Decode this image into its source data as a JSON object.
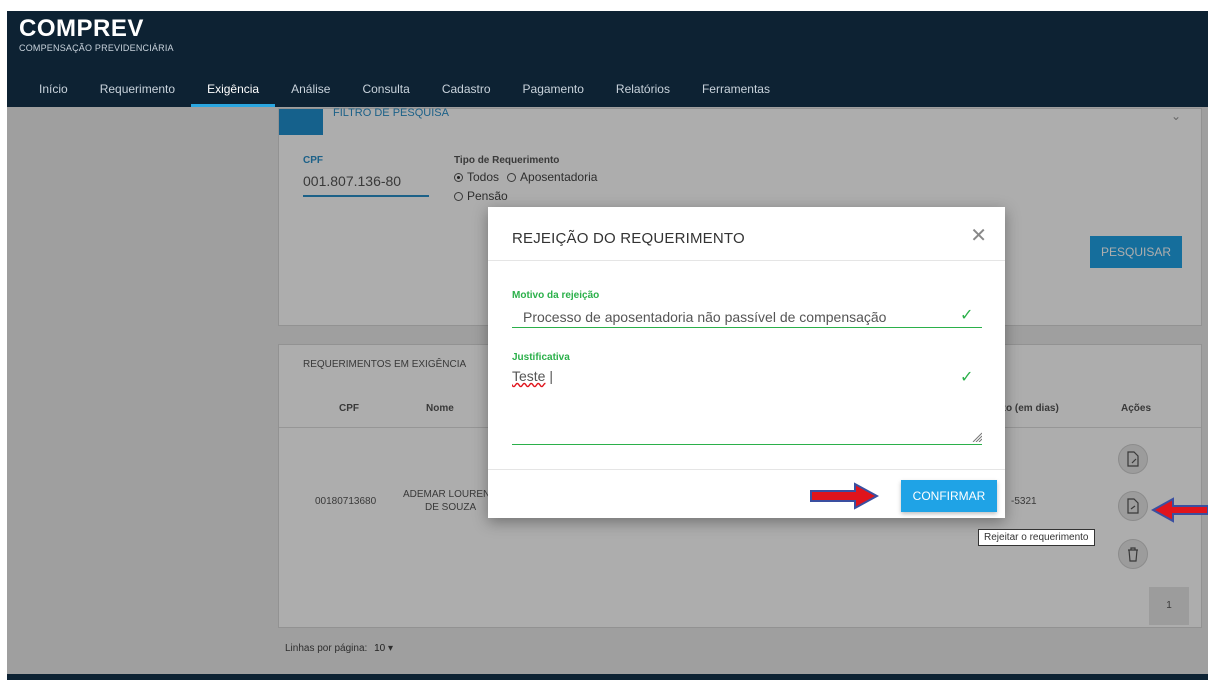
{
  "app": {
    "name": "COMPREV",
    "subtitle": "COMPENSAÇÃO PREVIDENCIÁRIA"
  },
  "nav": {
    "items": [
      {
        "label": "Início"
      },
      {
        "label": "Requerimento"
      },
      {
        "label": "Exigência",
        "active": true
      },
      {
        "label": "Análise"
      },
      {
        "label": "Consulta"
      },
      {
        "label": "Cadastro"
      },
      {
        "label": "Pagamento"
      },
      {
        "label": "Relatórios"
      },
      {
        "label": "Ferramentas"
      }
    ]
  },
  "filter": {
    "title": "FILTRO DE PESQUISA",
    "cpf_label": "CPF",
    "cpf_value": "001.807.136-80",
    "tipo_label": "Tipo de Requerimento",
    "options": [
      "Todos",
      "Aposentadoria",
      "Pensão"
    ],
    "selected": "Todos",
    "search_button": "PESQUISAR"
  },
  "table": {
    "title": "REQUERIMENTOS EM EXIGÊNCIA",
    "headers": {
      "cpf": "CPF",
      "nome": "Nome",
      "prazo": "zo (em dias)",
      "acoes": "Ações"
    },
    "rows": [
      {
        "cpf": "00180713680",
        "nome_line1": "ADEMAR LOUREN",
        "nome_line2": "DE SOUZA",
        "prazo": "-5321"
      }
    ],
    "page": "1",
    "lines_per_page_label": "Linhas por página:",
    "lines_per_page_value": "10"
  },
  "modal": {
    "title": "REJEIÇÃO DO REQUERIMENTO",
    "motivo_label": "Motivo da rejeição",
    "motivo_value": "Processo de aposentadoria não passível de compensação",
    "justificativa_label": "Justificativa",
    "justificativa_value": "Teste",
    "confirm_button": "CONFIRMAR"
  },
  "tooltip": {
    "text": "Rejeitar o requerimento"
  },
  "colors": {
    "header": "#0d2233",
    "accent": "#1fa3e6",
    "valid": "#2bb04a",
    "arrow": "#e0141c"
  }
}
